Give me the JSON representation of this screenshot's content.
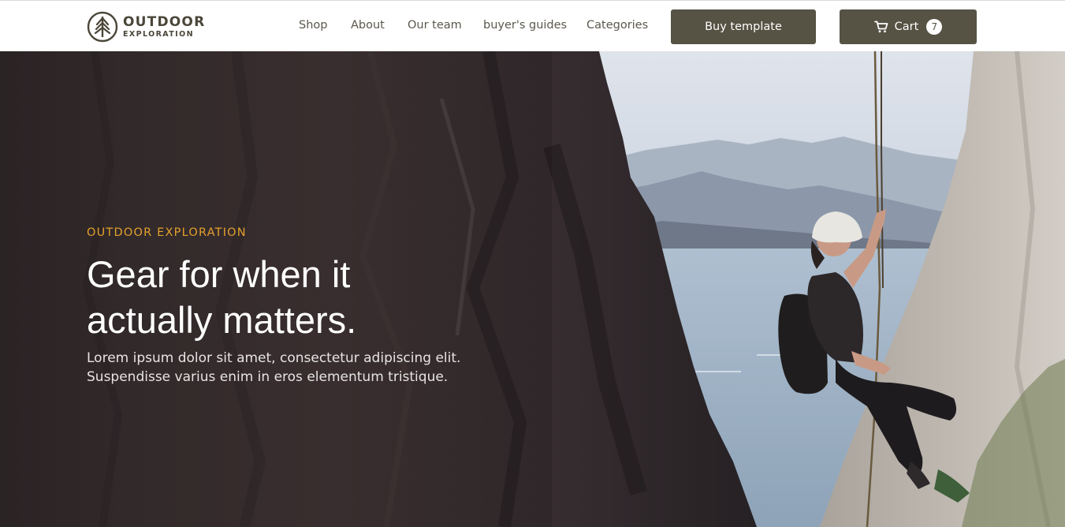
{
  "brand": {
    "line1": "OUTDOOR",
    "line2": "EXPLORATION",
    "logo_icon": "tree-in-circle-icon"
  },
  "nav": {
    "links": [
      "Shop",
      "About",
      "Our team",
      "buyer's guides",
      "Categories"
    ],
    "buy_label": "Buy template",
    "cart_label": "Cart",
    "cart_count": "7",
    "cart_icon": "shopping-cart-icon"
  },
  "hero": {
    "eyebrow": "OUTDOOR EXPLORATION",
    "headline": "Gear for when it actually matters.",
    "subtext": "Lorem ipsum dolor sit amet, consectetur adipiscing elit. Suspendisse varius enim in eros elementum tristique.",
    "image": "rock-climber-rappelling-cliff-photo"
  },
  "colors": {
    "button_bg": "#565244",
    "eyebrow": "#e3a02e",
    "brand_text": "#4a4639",
    "nav_text": "#5b574c"
  }
}
